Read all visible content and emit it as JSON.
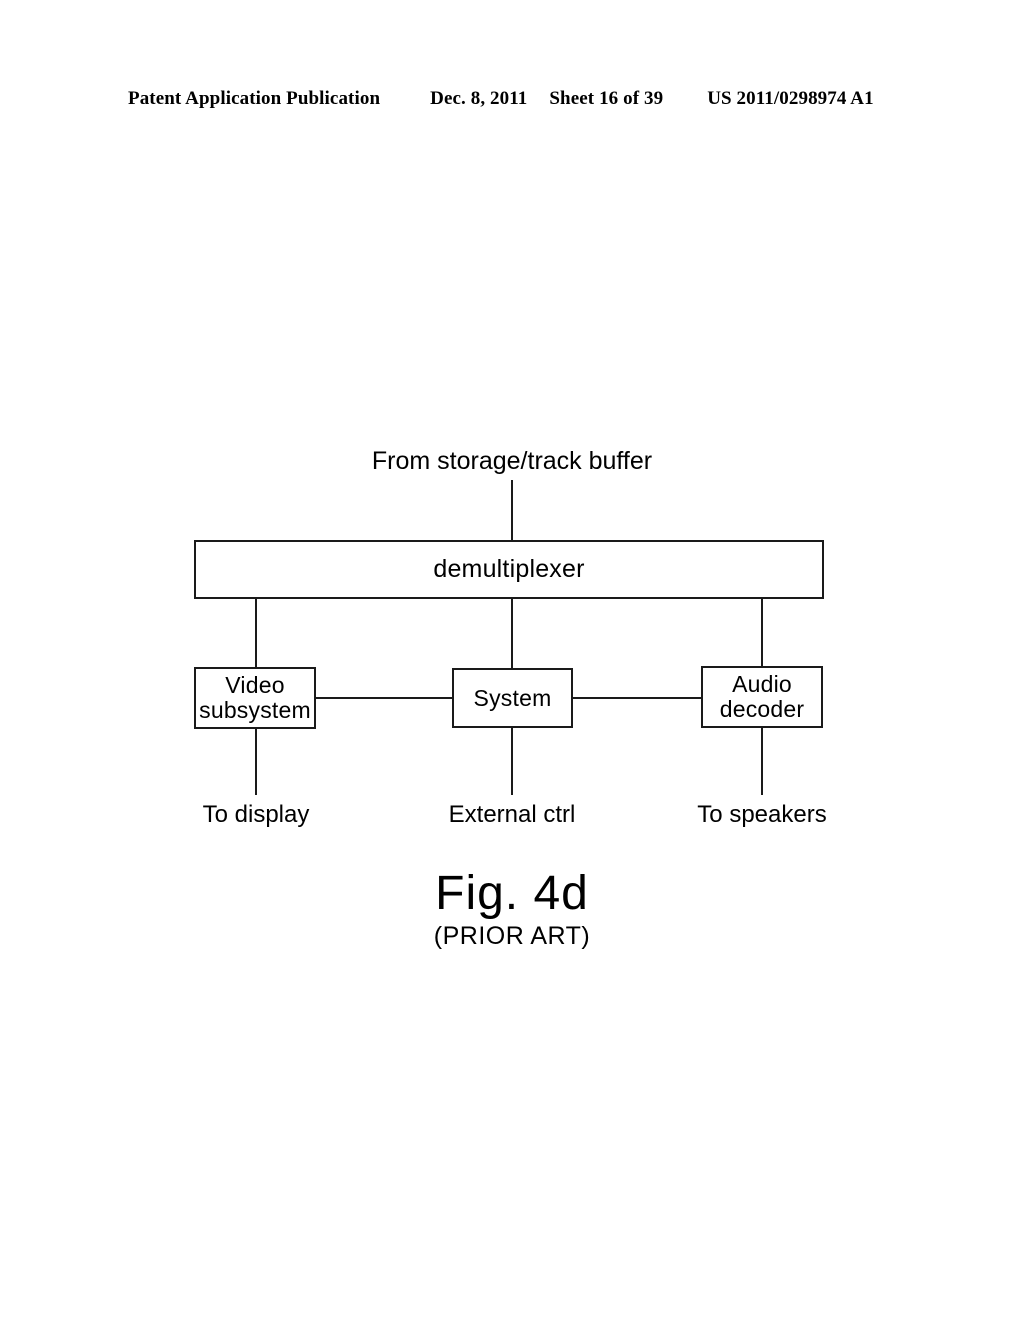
{
  "header": {
    "publication": "Patent Application Publication",
    "date": "Dec. 8, 2011",
    "sheet": "Sheet 16 of 39",
    "number": "US 2011/0298974 A1"
  },
  "figure": {
    "source_label": "From storage/track buffer",
    "blocks": {
      "demultiplexer": "demultiplexer",
      "video_subsystem_line1": "Video",
      "video_subsystem_line2": "subsystem",
      "system": "System",
      "audio_decoder_line1": "Audio",
      "audio_decoder_line2": "decoder"
    },
    "outputs": {
      "display": "To display",
      "external": "External ctrl",
      "speakers": "To speakers"
    },
    "title": "Fig. 4d",
    "subtitle": "(PRIOR ART)"
  },
  "colors": {
    "ink": "#1a1a1a",
    "page": "#ffffff"
  }
}
